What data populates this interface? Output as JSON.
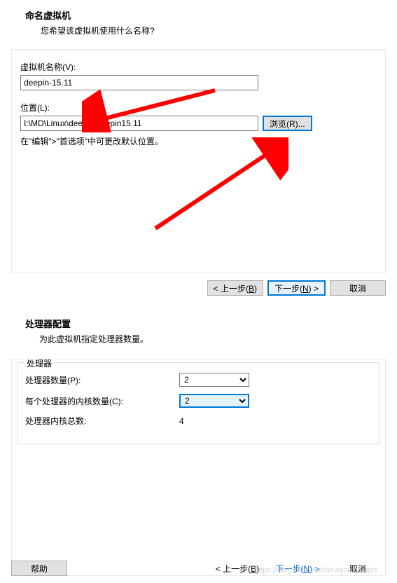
{
  "dialog1": {
    "title": "命名虚拟机",
    "subtitle": "您希望该虚拟机使用什么名称?",
    "name_label": "虚拟机名称(V):",
    "name_value": "deepin-15.11",
    "location_label": "位置(L):",
    "location_value": "I:\\MD\\Linux\\deepin\\deepin15.11",
    "browse_label": "浏览(R)...",
    "hint": "在\"编辑\">\"首选项\"中可更改默认位置。",
    "back_label": "< 上一步(B)",
    "next_label": "下一步(N) >",
    "cancel_label": "取消"
  },
  "dialog2": {
    "title": "处理器配置",
    "subtitle": "为此虚拟机指定处理器数量。",
    "group_label": "处理器",
    "proc_count_label": "处理器数量(P):",
    "proc_count_value": "2",
    "cores_label": "每个处理器的内核数量(C):",
    "cores_value": "2",
    "total_label": "处理器内核总数:",
    "total_value": "4",
    "help_label": "帮助",
    "back_label": "< 上一步(B)",
    "next_label": "下一步(N) >",
    "cancel_label": "取消"
  },
  "watermark": "https://blog.csdn.net/devolcqzyxnjds"
}
